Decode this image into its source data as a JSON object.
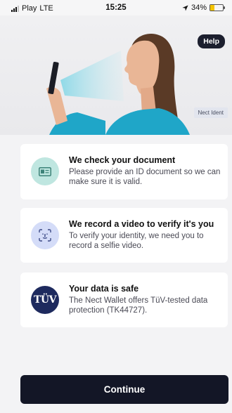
{
  "status_bar": {
    "carrier": "Play",
    "network": "LTE",
    "time": "15:25",
    "battery": "34%",
    "battery_level": 0.34
  },
  "hero": {
    "help_label": "Help",
    "brand_tag": "Nect Ident"
  },
  "cards": [
    {
      "icon": "id-card-icon",
      "icon_bg": "#bfe6e0",
      "icon_color": "#3c8278",
      "title": "We check your document",
      "text": "Please provide an ID document so we can make sure it is valid."
    },
    {
      "icon": "face-scan-icon",
      "icon_bg": "#d4dcf8",
      "icon_color": "#3c4a86",
      "title": "We record a video to verify it's you",
      "text": "To verify your identity, we need you to record a selfie video."
    },
    {
      "icon": "tuv-logo",
      "logo_text": "TÜV",
      "icon_bg": "#1e2a5e",
      "icon_color": "#ffffff",
      "title": "Your data is safe",
      "text": "The Nect Wallet offers TüV-tested data protection (TK44727)."
    }
  ],
  "continue_label": "Continue"
}
